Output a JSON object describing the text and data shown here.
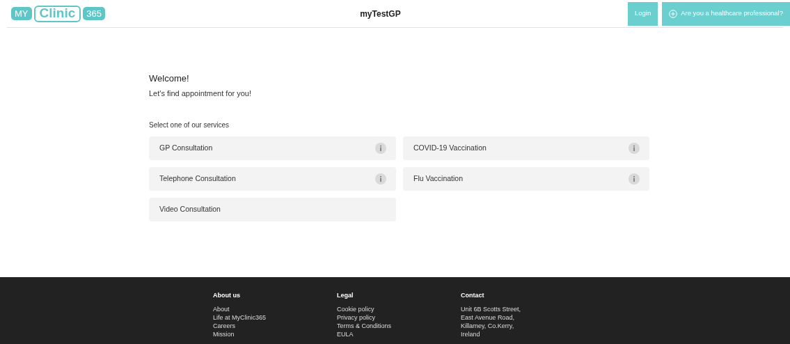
{
  "header": {
    "logo": [
      "MY",
      "Clinic",
      "365"
    ],
    "title": "myTestGP",
    "buttons": [
      {
        "kind": "plain",
        "label": "Login"
      },
      {
        "kind": "plus",
        "label": "Are you a healthcare professional?"
      }
    ]
  },
  "welcome": {
    "heading": "Welcome!",
    "subheading": "Let's find appointment for you!"
  },
  "services": {
    "label": "Select one of our services",
    "items": [
      {
        "name": "GP Consultation",
        "info": true
      },
      {
        "name": "COVID-19 Vaccination",
        "info": true
      },
      {
        "name": "Telephone Consultation",
        "info": true
      },
      {
        "name": "Flu Vaccination",
        "info": true
      },
      {
        "name": "Video Consultation",
        "info": false
      }
    ]
  },
  "footer": {
    "columns": [
      {
        "heading": "About us",
        "lines": [
          "About",
          "Life at MyClinic365",
          "Careers",
          "Mission"
        ]
      },
      {
        "heading": "Legal",
        "lines": [
          "Cookie policy",
          "Privacy policy",
          "Terms & Conditions",
          "EULA"
        ]
      },
      {
        "heading": "Contact",
        "lines": [
          "Unit 6B Scotts Street,",
          "East Avenue Road,",
          "Killarney, Co.Kerry,",
          "Ireland"
        ]
      }
    ]
  }
}
